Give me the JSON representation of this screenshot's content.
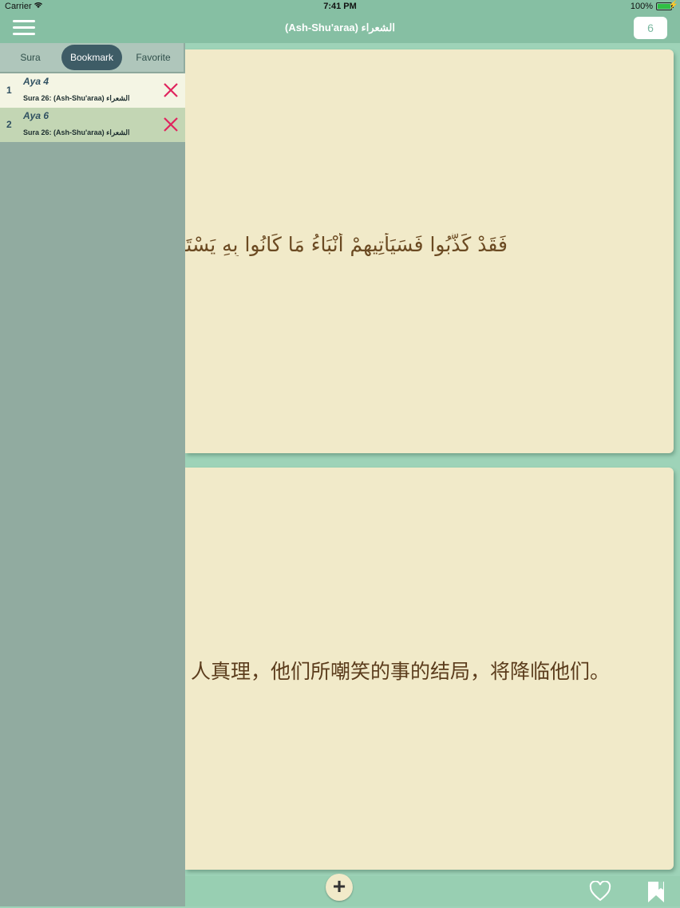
{
  "status_bar": {
    "carrier": "Carrier",
    "time": "7:41 PM",
    "battery": "100%"
  },
  "nav": {
    "title": "(Ash-Shu'araa) الشعراء",
    "page_number": "6"
  },
  "segments": {
    "sura": "Sura",
    "bookmark": "Bookmark",
    "favorite": "Favorite",
    "selected": "Bookmark"
  },
  "bookmarks": [
    {
      "number": "1",
      "aya": "Aya 4",
      "sura": "Sura 26: (Ash-Shu'araa) الشعراء"
    },
    {
      "number": "2",
      "aya": "Aya 6",
      "sura": "Sura 26: (Ash-Shu'araa) الشعراء"
    }
  ],
  "verse": {
    "arabic": "فَقَدْ كَذَّبُوا فَسَيَأْتِيهِمْ أَنْبَاءُ مَا كَانُوا بِهِ يَسْتَهْزِئُونَ",
    "translation": "人真理，他们所嘲笑的事的结局，将降临他们。"
  },
  "toolbar": {
    "add_label": "+"
  },
  "colors": {
    "nav": "#86bfa3",
    "card": "#f1eac9",
    "panel": "#91aba0",
    "delete": "#e0245e",
    "segment_selected": "#3e5c66"
  },
  "icons": [
    "menu-icon",
    "wifi-icon",
    "battery-icon",
    "close-icon",
    "plus-icon",
    "heart-icon",
    "bookmark-icon"
  ]
}
